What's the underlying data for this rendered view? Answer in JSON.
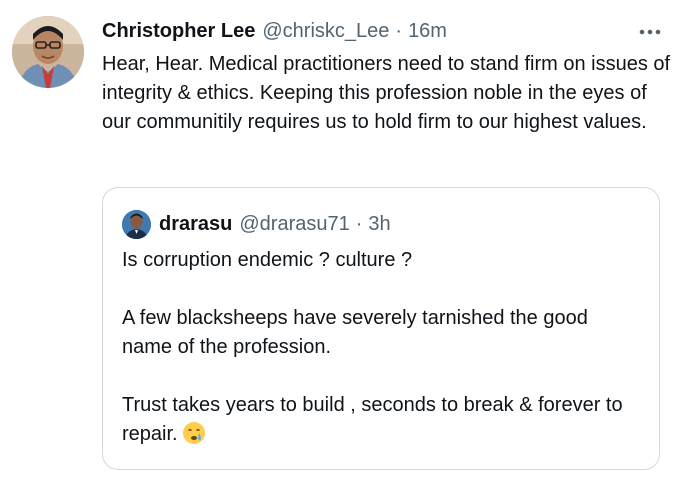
{
  "tweet": {
    "author": {
      "display_name": "Christopher Lee",
      "handle": "@chriskc_Lee",
      "separator": "·",
      "time": "16m",
      "avatar_icon": "profile-photo"
    },
    "more_icon": "more-horizontal-icon",
    "text": "Hear, Hear. Medical practitioners need to stand firm on issues of integrity & ethics. Keeping this profession noble in the eyes of our communitily requires us to hold firm to our highest values."
  },
  "quote": {
    "author": {
      "display_name": "drarasu",
      "handle": "@drarasu71",
      "separator": "·",
      "time": "3h",
      "avatar_icon": "profile-photo"
    },
    "paragraphs": [
      "Is corruption endemic ? culture ?",
      "A few blacksheeps have severely tarnished the good name of the profession.",
      "Trust takes years to build , seconds to break & forever to repair."
    ],
    "emoji": "crying-face-emoji"
  },
  "colors": {
    "text_primary": "#0f1419",
    "text_secondary": "#536471",
    "border": "#cfd9de",
    "background": "#ffffff"
  }
}
